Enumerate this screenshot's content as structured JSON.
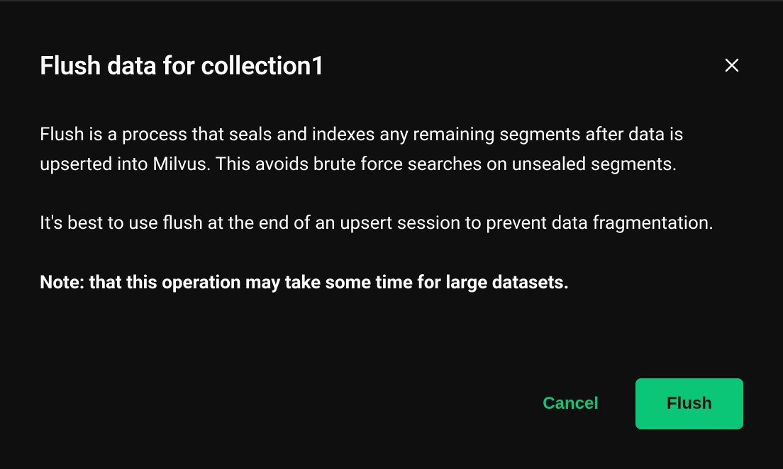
{
  "dialog": {
    "title": "Flush data for collection1",
    "body": {
      "paragraph1": "Flush is a process that seals and indexes any remaining segments after data is upserted into Milvus. This avoids brute force searches on unsealed segments.",
      "paragraph2": "It's best to use flush at the end of an upsert session to prevent data fragmentation.",
      "note": "Note: that this operation may take some time for large datasets."
    },
    "footer": {
      "cancel_label": "Cancel",
      "confirm_label": "Flush"
    }
  }
}
